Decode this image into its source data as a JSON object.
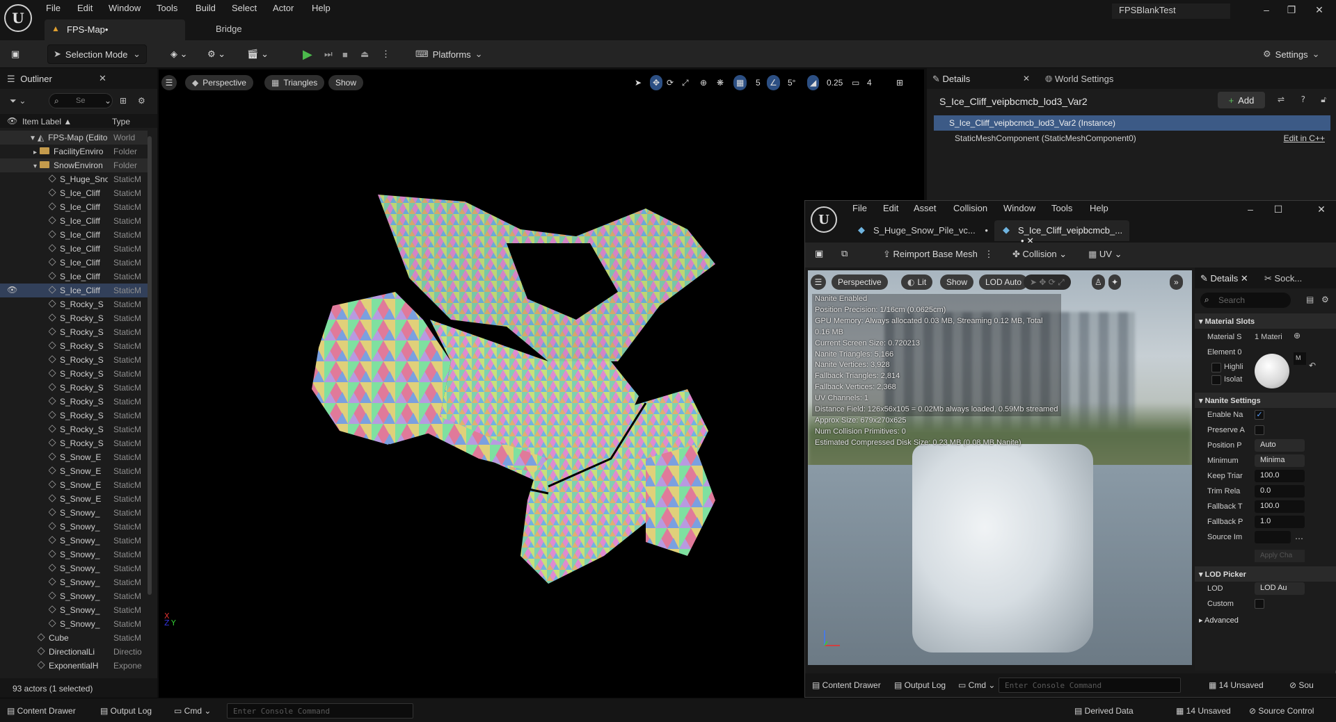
{
  "menu": {
    "file": "File",
    "edit": "Edit",
    "window": "Window",
    "tools": "Tools",
    "build": "Build",
    "select": "Select",
    "actor": "Actor",
    "help": "Help"
  },
  "project_name": "FPSBlankTest",
  "tabs": {
    "map": "FPS-Map•",
    "bridge": "Bridge"
  },
  "toolbar": {
    "selection_mode": "Selection Mode",
    "platforms": "Platforms",
    "settings": "Settings"
  },
  "outliner": {
    "title": "Outliner",
    "search_placeholder": "Se",
    "col_label": "Item Label ▲",
    "col_type": "Type",
    "rows": [
      {
        "label": "FPS-Map (Editor)",
        "type": "World"
      },
      {
        "label": "FacilityEnviro",
        "type": "Folder"
      },
      {
        "label": "SnowEnviron",
        "type": "Folder"
      },
      {
        "label": "S_Huge_Sno",
        "type": "StaticM"
      },
      {
        "label": "S_Ice_Cliff",
        "type": "StaticM"
      },
      {
        "label": "S_Ice_Cliff",
        "type": "StaticM"
      },
      {
        "label": "S_Ice_Cliff",
        "type": "StaticM"
      },
      {
        "label": "S_Ice_Cliff",
        "type": "StaticM"
      },
      {
        "label": "S_Ice_Cliff",
        "type": "StaticM"
      },
      {
        "label": "S_Ice_Cliff",
        "type": "StaticM"
      },
      {
        "label": "S_Ice_Cliff",
        "type": "StaticM"
      },
      {
        "label": "S_Ice_Cliff",
        "type": "StaticM"
      },
      {
        "label": "S_Rocky_S",
        "type": "StaticM"
      },
      {
        "label": "S_Rocky_S",
        "type": "StaticM"
      },
      {
        "label": "S_Rocky_S",
        "type": "StaticM"
      },
      {
        "label": "S_Rocky_S",
        "type": "StaticM"
      },
      {
        "label": "S_Rocky_S",
        "type": "StaticM"
      },
      {
        "label": "S_Rocky_S",
        "type": "StaticM"
      },
      {
        "label": "S_Rocky_S",
        "type": "StaticM"
      },
      {
        "label": "S_Rocky_S",
        "type": "StaticM"
      },
      {
        "label": "S_Rocky_S",
        "type": "StaticM"
      },
      {
        "label": "S_Rocky_S",
        "type": "StaticM"
      },
      {
        "label": "S_Rocky_S",
        "type": "StaticM"
      },
      {
        "label": "S_Snow_E",
        "type": "StaticM"
      },
      {
        "label": "S_Snow_E",
        "type": "StaticM"
      },
      {
        "label": "S_Snow_E",
        "type": "StaticM"
      },
      {
        "label": "S_Snow_E",
        "type": "StaticM"
      },
      {
        "label": "S_Snowy_",
        "type": "StaticM"
      },
      {
        "label": "S_Snowy_",
        "type": "StaticM"
      },
      {
        "label": "S_Snowy_",
        "type": "StaticM"
      },
      {
        "label": "S_Snowy_",
        "type": "StaticM"
      },
      {
        "label": "S_Snowy_",
        "type": "StaticM"
      },
      {
        "label": "S_Snowy_",
        "type": "StaticM"
      },
      {
        "label": "S_Snowy_",
        "type": "StaticM"
      },
      {
        "label": "S_Snowy_",
        "type": "StaticM"
      },
      {
        "label": "S_Snowy_",
        "type": "StaticM"
      },
      {
        "label": "Cube",
        "type": "StaticM"
      },
      {
        "label": "DirectionalLi",
        "type": "Directio"
      },
      {
        "label": "ExponentialH",
        "type": "Expone"
      }
    ],
    "status": "93 actors (1 selected)"
  },
  "viewport": {
    "perspective": "Perspective",
    "view_mode": "Triangles",
    "show": "Show",
    "grid": "5",
    "angle": "5°",
    "scale": "0.25",
    "camera": "4"
  },
  "details": {
    "tab": "Details",
    "tab2": "World Settings",
    "actor_name": "S_Ice_Cliff_veipbcmcb_lod3_Var2",
    "add": "Add",
    "component_selected": "S_Ice_Cliff_veipbcmcb_lod3_Var2 (Instance)",
    "component_child": "StaticMeshComponent (StaticMeshComponent0)",
    "edit_cpp": "Edit in C++"
  },
  "mesh_editor": {
    "menu": {
      "file": "File",
      "edit": "Edit",
      "asset": "Asset",
      "collision": "Collision",
      "window": "Window",
      "tools": "Tools",
      "help": "Help"
    },
    "tab1": "S_Huge_Snow_Pile_vc...",
    "tab2": "S_Ice_Cliff_veipbcmcb_...",
    "reimport": "Reimport Base Mesh",
    "collision": "Collision",
    "uv": "UV",
    "vp": {
      "perspective": "Perspective",
      "lit": "Lit",
      "show": "Show",
      "lod": "LOD Auto"
    },
    "info": [
      "Nanite Enabled",
      "Position Precision: 1/16cm (0.0625cm)",
      "GPU Memory: Always allocated 0.03 MB, Streaming 0.12 MB, Total 0.16 MB",
      "Current Screen Size: 0.720213",
      "Nanite Triangles: 5,166",
      "Nanite Vertices: 3,928",
      "Fallback Triangles: 2,814",
      "Fallback Vertices: 2,368",
      "UV Channels: 1",
      "Distance Field: 126x56x105 = 0.02Mb always loaded, 0.59Mb streamed",
      "Approx Size: 679x270x625",
      "Num Collision Primitives: 0",
      "Estimated Compressed Disk Size: 0.23 MB (0.08 MB Nanite)"
    ],
    "details_tab": "Details",
    "sockets_tab": "Sock...",
    "search_placeholder": "Search",
    "cat_material": "Material Slots",
    "material_slots_label": "Material S",
    "material_slots_value": "1 Materi",
    "element0": "Element 0",
    "highlight": "Highli",
    "isolate": "Isolat",
    "cat_nanite": "Nanite Settings",
    "enable_nanite": "Enable Na",
    "preserve": "Preserve A",
    "position_precision": "Position P",
    "position_value": "Auto",
    "minimum": "Minimum",
    "minimum_value": "Minima",
    "keep_tri": "Keep Triar",
    "keep_tri_value": "100.0",
    "trim_rel": "Trim Rela",
    "trim_rel_value": "0.0",
    "fallback_t": "Fallback T",
    "fallback_t_value": "100.0",
    "fallback_p": "Fallback P",
    "fallback_p_value": "1.0",
    "source_im": "Source Im",
    "apply": "Apply Cha",
    "cat_lod": "LOD Picker",
    "lod_label": "LOD",
    "lod_value": "LOD Au",
    "custom": "Custom",
    "advanced": "Advanced",
    "bottom": {
      "content_drawer": "Content Drawer",
      "output_log": "Output Log",
      "cmd": "Cmd",
      "console_placeholder": "Enter Console Command",
      "unsaved": "14 Unsaved",
      "source": "Sou"
    }
  },
  "statusbar": {
    "content_drawer": "Content Drawer",
    "output_log": "Output Log",
    "cmd": "Cmd",
    "console_placeholder": "Enter Console Command",
    "derived_data": "Derived Data",
    "unsaved": "14 Unsaved",
    "source_control": "Source Control"
  }
}
